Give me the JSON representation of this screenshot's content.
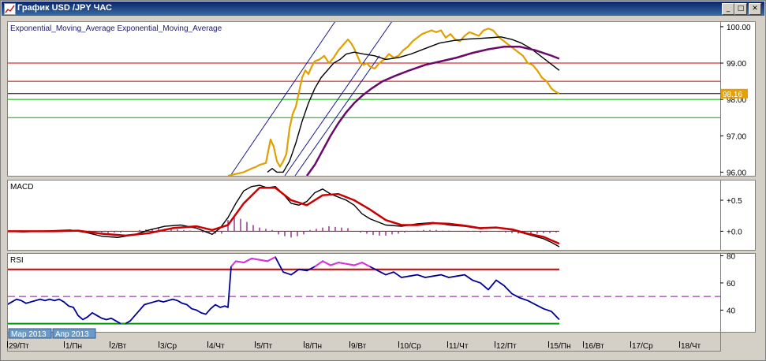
{
  "window": {
    "title": "График USD /JPY  ЧАС",
    "buttons": {
      "minimize": "_",
      "maximize": "□",
      "close": "✕"
    }
  },
  "chart_data": [
    {
      "name": "price",
      "type": "line",
      "indicator_label": "Exponential_Moving_Average Exponential_Moving_Average",
      "y_ticks": [
        100.0,
        99.0,
        98.0,
        97.0,
        96.0
      ],
      "y_tick_labels": [
        "100.00",
        "99.00",
        "98.00",
        "97.00",
        "96.00"
      ],
      "ylim": [
        95.9,
        100.15
      ],
      "last_price": 98.16,
      "last_price_label": "98.16",
      "horizontal_lines": [
        {
          "y": 99.0,
          "color": "#cc0000"
        },
        {
          "y": 98.5,
          "color": "#cc0000"
        },
        {
          "y": 98.16,
          "color": "#000000"
        },
        {
          "y": 98.0,
          "color": "#00aa00"
        },
        {
          "y": 97.5,
          "color": "#00aa00"
        }
      ],
      "series": [
        {
          "name": "close",
          "color": "#e0a000",
          "x": [
            280,
            290,
            300,
            305,
            310,
            316,
            320,
            328,
            334,
            338,
            342,
            346,
            350,
            354,
            358,
            362,
            366,
            370,
            374,
            378,
            382,
            386,
            390,
            396,
            402,
            408,
            414,
            420,
            426,
            432,
            436,
            440,
            444,
            448,
            452,
            456,
            460,
            466,
            472,
            478,
            484,
            490,
            496,
            502,
            508,
            514,
            520,
            526,
            532,
            538,
            544,
            550,
            556,
            562,
            568,
            574,
            580,
            586,
            592,
            598,
            604,
            610,
            616,
            620,
            624,
            630,
            636,
            642,
            648,
            654,
            660,
            666,
            672,
            678,
            684,
            690,
            696,
            700
          ],
          "y": [
            95.9,
            95.95,
            96.0,
            96.05,
            96.1,
            96.15,
            96.2,
            96.25,
            96.9,
            96.7,
            96.3,
            96.15,
            96.3,
            96.5,
            97.2,
            97.6,
            97.8,
            98.2,
            98.6,
            98.8,
            98.7,
            98.9,
            99.05,
            99.1,
            99.2,
            99.0,
            99.15,
            99.35,
            99.5,
            99.65,
            99.55,
            99.4,
            99.2,
            99.0,
            98.95,
            99.0,
            98.9,
            98.85,
            99.0,
            99.1,
            99.25,
            99.15,
            99.2,
            99.35,
            99.45,
            99.6,
            99.7,
            99.8,
            99.85,
            99.9,
            99.85,
            99.9,
            99.7,
            99.8,
            99.65,
            99.6,
            99.75,
            99.85,
            99.8,
            99.75,
            99.9,
            99.95,
            99.9,
            99.8,
            99.7,
            99.6,
            99.5,
            99.4,
            99.3,
            99.2,
            99.0,
            98.95,
            98.8,
            98.6,
            98.5,
            98.3,
            98.2,
            98.16
          ]
        },
        {
          "name": "ema_fast",
          "color": "#000000",
          "x": [
            330,
            336,
            342,
            350,
            358,
            366,
            374,
            382,
            390,
            398,
            406,
            414,
            422,
            430,
            440,
            452,
            466,
            480,
            496,
            512,
            530,
            548,
            566,
            584,
            600,
            614,
            626,
            640,
            652,
            664,
            676,
            688,
            700
          ],
          "y": [
            96.0,
            96.1,
            96.0,
            96.0,
            96.3,
            96.8,
            97.4,
            97.9,
            98.3,
            98.6,
            98.8,
            99.0,
            99.1,
            99.25,
            99.3,
            99.25,
            99.2,
            99.1,
            99.15,
            99.25,
            99.4,
            99.55,
            99.62,
            99.66,
            99.68,
            99.7,
            99.72,
            99.65,
            99.55,
            99.4,
            99.2,
            99.0,
            98.8
          ]
        },
        {
          "name": "ema_slow",
          "color": "#6a0a6a",
          "x": [
            380,
            390,
            400,
            410,
            420,
            430,
            440,
            450,
            462,
            476,
            492,
            510,
            530,
            550,
            570,
            590,
            610,
            630,
            650,
            670,
            688,
            700
          ],
          "y": [
            95.9,
            96.2,
            96.6,
            97.0,
            97.35,
            97.65,
            97.9,
            98.1,
            98.3,
            98.5,
            98.65,
            98.8,
            98.95,
            99.05,
            99.15,
            99.28,
            99.38,
            99.45,
            99.45,
            99.35,
            99.22,
            99.12
          ]
        }
      ],
      "trend_channel": [
        {
          "x1": 283,
          "y1": 95.9,
          "x2": 416,
          "y2": 100.15
        },
        {
          "x1": 352,
          "y1": 95.9,
          "x2": 488,
          "y2": 100.15
        },
        {
          "x1": 365,
          "y1": 95.9,
          "x2": 472,
          "y2": 99.2
        }
      ]
    },
    {
      "name": "macd",
      "type": "line",
      "indicator_label": "MACD",
      "y_ticks": [
        0.5,
        0.0
      ],
      "y_tick_labels": [
        "+0.5",
        "+0.0"
      ],
      "ylim": [
        -0.3,
        0.83
      ],
      "series": [
        {
          "name": "macd",
          "color": "#000000",
          "x": [
            0,
            20,
            40,
            60,
            80,
            100,
            120,
            140,
            160,
            180,
            200,
            220,
            240,
            260,
            270,
            280,
            290,
            300,
            310,
            320,
            330,
            340,
            350,
            360,
            370,
            380,
            390,
            400,
            410,
            420,
            430,
            440,
            450,
            460,
            480,
            500,
            520,
            540,
            560,
            580,
            600,
            620,
            640,
            660,
            680,
            690,
            700
          ],
          "y": [
            0.0,
            -0.01,
            0.0,
            0.01,
            0.02,
            -0.02,
            -0.08,
            -0.1,
            -0.06,
            0.02,
            0.08,
            0.1,
            0.05,
            -0.05,
            0.05,
            0.22,
            0.45,
            0.65,
            0.72,
            0.74,
            0.7,
            0.72,
            0.6,
            0.45,
            0.42,
            0.48,
            0.62,
            0.68,
            0.6,
            0.55,
            0.5,
            0.42,
            0.28,
            0.2,
            0.1,
            0.08,
            0.12,
            0.14,
            0.1,
            0.08,
            0.04,
            0.06,
            0.02,
            -0.05,
            -0.12,
            -0.18,
            -0.25
          ]
        },
        {
          "name": "signal",
          "color": "#cc0000",
          "x": [
            0,
            30,
            60,
            90,
            120,
            150,
            180,
            210,
            240,
            260,
            280,
            300,
            320,
            340,
            360,
            380,
            400,
            420,
            440,
            460,
            480,
            500,
            520,
            540,
            560,
            580,
            600,
            620,
            640,
            660,
            680,
            700
          ],
          "y": [
            0.0,
            0.0,
            0.0,
            0.01,
            -0.04,
            -0.07,
            -0.03,
            0.05,
            0.08,
            0.02,
            0.1,
            0.45,
            0.7,
            0.7,
            0.5,
            0.42,
            0.58,
            0.6,
            0.5,
            0.35,
            0.18,
            0.1,
            0.1,
            0.13,
            0.12,
            0.09,
            0.05,
            0.06,
            0.03,
            -0.04,
            -0.09,
            -0.2
          ]
        }
      ],
      "histogram": {
        "color": "#8a2a8a",
        "x": [
          0,
          8,
          16,
          24,
          32,
          40,
          48,
          56,
          64,
          72,
          80,
          88,
          96,
          104,
          112,
          120,
          128,
          136,
          144,
          152,
          160,
          168,
          176,
          184,
          192,
          200,
          208,
          216,
          224,
          232,
          240,
          248,
          256,
          264,
          272,
          280,
          288,
          296,
          304,
          312,
          320,
          328,
          336,
          344,
          352,
          360,
          368,
          376,
          384,
          392,
          400,
          408,
          416,
          424,
          432,
          440,
          448,
          456,
          464,
          472,
          480,
          488,
          496,
          504,
          512,
          520,
          528,
          536,
          544,
          552,
          560,
          568,
          576,
          584,
          592,
          600,
          608,
          616,
          624,
          632,
          640,
          648,
          656,
          664,
          672,
          680,
          688,
          696
        ],
        "y": [
          0.0,
          0.0,
          -0.01,
          0.0,
          0.01,
          0.0,
          0.01,
          0.01,
          0.01,
          0.01,
          0.02,
          0.02,
          0.01,
          0.01,
          -0.01,
          -0.02,
          -0.03,
          -0.02,
          -0.02,
          0.0,
          -0.01,
          0.02,
          0.03,
          0.04,
          0.05,
          0.04,
          0.04,
          0.03,
          0.02,
          0.01,
          0.0,
          -0.02,
          -0.03,
          -0.04,
          -0.04,
          0.18,
          0.22,
          0.2,
          0.15,
          0.1,
          0.06,
          0.04,
          0.02,
          -0.05,
          -0.08,
          -0.1,
          -0.08,
          -0.05,
          0.02,
          0.04,
          0.06,
          0.08,
          0.07,
          0.06,
          0.05,
          0.0,
          -0.02,
          -0.04,
          -0.06,
          -0.07,
          -0.07,
          -0.05,
          -0.04,
          -0.02,
          0.0,
          0.01,
          0.02,
          0.02,
          0.02,
          0.01,
          0.01,
          0.0,
          0.0,
          -0.01,
          -0.01,
          -0.02,
          -0.01,
          0.0,
          -0.01,
          -0.02,
          -0.03,
          -0.04,
          -0.05,
          -0.05,
          -0.04,
          -0.03,
          -0.03,
          -0.02
        ]
      }
    },
    {
      "name": "rsi",
      "type": "line",
      "indicator_label": "RSI",
      "y_ticks": [
        80,
        60,
        40
      ],
      "y_tick_labels": [
        "80",
        "60",
        "40"
      ],
      "ylim": [
        24,
        82
      ],
      "levels": [
        {
          "y": 70,
          "color": "#cc0000",
          "style": "solid"
        },
        {
          "y": 50,
          "color": "#7a1a8a",
          "style": "dashed"
        },
        {
          "y": 30,
          "color": "#009900",
          "style": "solid"
        }
      ],
      "overbought_color": "#dd33dd",
      "oversold_color": "#00aa00",
      "series": [
        {
          "name": "rsi",
          "color": "#000099",
          "x": [
            0,
            6,
            12,
            18,
            24,
            30,
            36,
            42,
            48,
            54,
            60,
            66,
            72,
            78,
            84,
            90,
            96,
            102,
            108,
            114,
            120,
            126,
            132,
            138,
            144,
            150,
            156,
            162,
            168,
            174,
            180,
            186,
            192,
            198,
            204,
            210,
            216,
            222,
            228,
            234,
            240,
            246,
            252,
            258,
            264,
            270,
            276,
            280,
            284,
            290,
            300,
            310,
            320,
            330,
            340,
            350,
            360,
            370,
            380,
            390,
            400,
            410,
            420,
            430,
            440,
            450,
            460,
            470,
            480,
            490,
            500,
            510,
            520,
            530,
            540,
            550,
            560,
            570,
            580,
            590,
            600,
            610,
            620,
            630,
            640,
            650,
            660,
            670,
            680,
            690,
            700
          ],
          "y": [
            44,
            46,
            48,
            47,
            45,
            46,
            47,
            48,
            47,
            48,
            47,
            48,
            46,
            43,
            42,
            36,
            33,
            35,
            38,
            36,
            34,
            33,
            34,
            32,
            30,
            30,
            32,
            36,
            40,
            44,
            45,
            46,
            47,
            46,
            47,
            48,
            47,
            45,
            44,
            41,
            40,
            38,
            37,
            41,
            44,
            42,
            43,
            42,
            72,
            76,
            75,
            78,
            77,
            76,
            79,
            68,
            66,
            70,
            69,
            72,
            76,
            73,
            75,
            74,
            73,
            75,
            72,
            69,
            66,
            68,
            64,
            65,
            66,
            64,
            65,
            66,
            64,
            65,
            66,
            62,
            60,
            55,
            62,
            58,
            52,
            49,
            47,
            44,
            41,
            39,
            33
          ]
        }
      ]
    }
  ],
  "x_axis": {
    "labels": [
      "29/Пт",
      "1/Пн",
      "2/Вт",
      "3/Ср",
      "4/Чт",
      "5/Пт",
      "8/Пн",
      "9/Вт",
      "10/Ср",
      "11/Чт",
      "12/Пт",
      "15/Пн",
      "16/Вт",
      "17/Ср",
      "18/Чт"
    ],
    "label_positions": [
      0,
      72,
      130,
      192,
      254,
      314,
      376,
      434,
      496,
      558,
      618,
      686,
      730,
      790,
      852
    ],
    "month_labels": [
      "Мар 2013",
      "Апр 2013"
    ]
  }
}
